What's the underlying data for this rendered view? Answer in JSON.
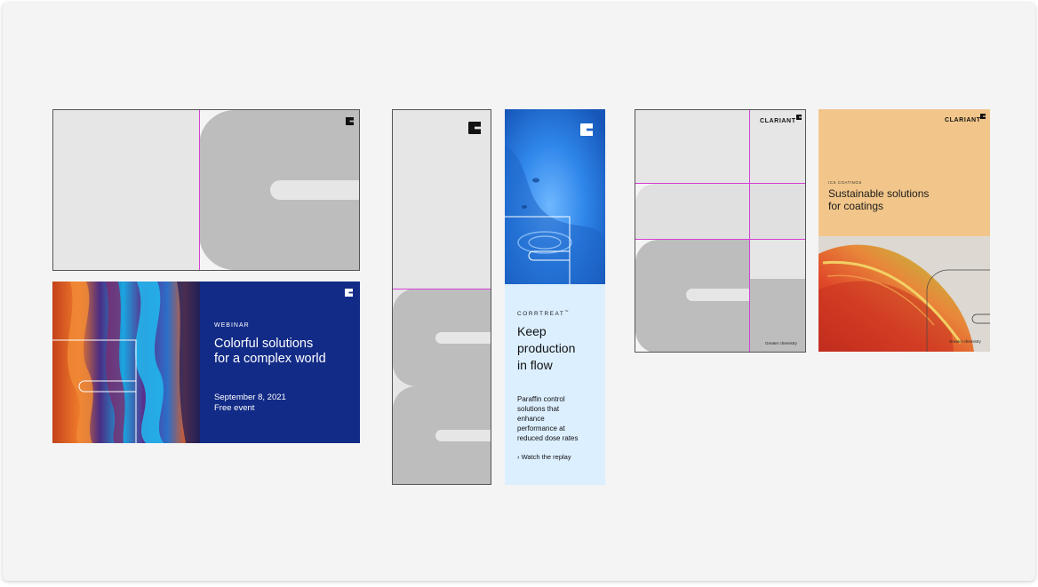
{
  "webinar": {
    "eyebrow": "WEBINAR",
    "title_line1": "Colorful solutions",
    "title_line2": "for a complex world",
    "date": "September 8, 2021",
    "event": "Free event"
  },
  "corrtreat": {
    "brand": "CORRTREAT",
    "brand_mark": "™",
    "title_lines": [
      "Keep",
      "production",
      "in flow"
    ],
    "description_lines": [
      "Paraffin control",
      "solutions that",
      "enhance",
      "performance at",
      "reduced dose rates"
    ],
    "link_label": "› Watch the replay"
  },
  "wireframe3": {
    "brand": "CLARIANT",
    "tagline": "Greater chemistry"
  },
  "coatings": {
    "brand": "CLARIANT",
    "eyebrow": "ICS COATINGS",
    "title_line1": "Sustainable solutions",
    "title_line2": "for coatings",
    "tagline": "Greater chemistry"
  },
  "colors": {
    "canvas": "#f4f4f4",
    "wire_light": "#e6e6e6",
    "wire_dark": "#bdbdbd",
    "guide": "#d63ed6",
    "webinar_blue": "#122b87",
    "corrtreat_panel": "#dcefff",
    "coatings_orange": "#f2c68a"
  },
  "icons": {
    "logo": "clariant-c-mark-icon"
  }
}
